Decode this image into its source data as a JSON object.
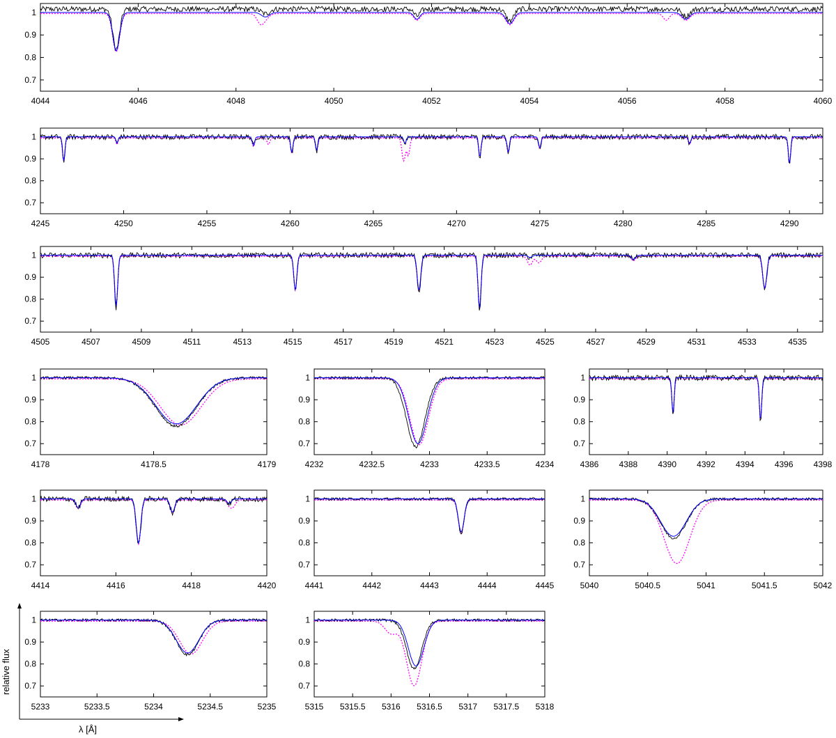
{
  "chart_data": [
    {
      "type": "line",
      "xlim": [
        4044,
        4060
      ],
      "ylim": [
        0.65,
        1.04
      ],
      "xticks": [
        "4044",
        "4046",
        "4048",
        "4050",
        "4052",
        "4054",
        "4056",
        "4058",
        "4060"
      ],
      "yticks": [
        "0.7",
        "0.8",
        "0.9",
        "1"
      ],
      "lines": [
        {
          "c": 4045.55,
          "d": 0.17,
          "w": 0.07
        },
        {
          "c": 4048.6,
          "d": 0.02,
          "w": 0.08
        },
        {
          "c": 4051.7,
          "d": 0.03,
          "w": 0.06
        },
        {
          "c": 4053.6,
          "d": 0.05,
          "w": 0.08
        },
        {
          "c": 4057.2,
          "d": 0.03,
          "w": 0.08
        }
      ],
      "extra": [
        {
          "c": 4048.5,
          "d": 0.04,
          "w": 0.07
        },
        {
          "c": 4056.8,
          "d": 0.03,
          "w": 0.06
        }
      ],
      "obs_offset": 0.015
    },
    {
      "type": "line",
      "xlim": [
        4245,
        4292
      ],
      "ylim": [
        0.65,
        1.04
      ],
      "xticks": [
        "4245",
        "4250",
        "4255",
        "4260",
        "4265",
        "4270",
        "4275",
        "4280",
        "4285",
        "4290"
      ],
      "yticks": [
        "0.7",
        "0.8",
        "0.9",
        "1"
      ],
      "lines": [
        {
          "c": 4246.4,
          "d": 0.11,
          "w": 0.07
        },
        {
          "c": 4249.6,
          "d": 0.03,
          "w": 0.06
        },
        {
          "c": 4257.8,
          "d": 0.04,
          "w": 0.07
        },
        {
          "c": 4260.1,
          "d": 0.07,
          "w": 0.07
        },
        {
          "c": 4261.6,
          "d": 0.06,
          "w": 0.07
        },
        {
          "c": 4266.9,
          "d": 0.03,
          "w": 0.07
        },
        {
          "c": 4271.4,
          "d": 0.09,
          "w": 0.07
        },
        {
          "c": 4273.1,
          "d": 0.07,
          "w": 0.07
        },
        {
          "c": 4275.0,
          "d": 0.05,
          "w": 0.07
        },
        {
          "c": 4284.0,
          "d": 0.03,
          "w": 0.07
        },
        {
          "c": 4290.0,
          "d": 0.12,
          "w": 0.07
        }
      ],
      "extra": [
        {
          "c": 4266.8,
          "d": 0.09,
          "w": 0.09
        },
        {
          "c": 4267.1,
          "d": 0.08,
          "w": 0.09
        },
        {
          "c": 4258.7,
          "d": 0.03,
          "w": 0.08
        }
      ],
      "obs_offset": 0
    },
    {
      "type": "line",
      "xlim": [
        4505,
        4536
      ],
      "ylim": [
        0.65,
        1.04
      ],
      "xticks": [
        "4505",
        "4507",
        "4509",
        "4511",
        "4513",
        "4515",
        "4517",
        "4519",
        "4521",
        "4523",
        "4525",
        "4527",
        "4529",
        "4531",
        "4533",
        "4535"
      ],
      "yticks": [
        "0.7",
        "0.8",
        "0.9",
        "1"
      ],
      "lines": [
        {
          "c": 4508.0,
          "d": 0.23,
          "w": 0.06
        },
        {
          "c": 4515.1,
          "d": 0.16,
          "w": 0.06
        },
        {
          "c": 4520.0,
          "d": 0.16,
          "w": 0.07
        },
        {
          "c": 4522.4,
          "d": 0.24,
          "w": 0.06
        },
        {
          "c": 4524.4,
          "d": 0.01,
          "w": 0.08
        },
        {
          "c": 4528.5,
          "d": 0.02,
          "w": 0.08
        },
        {
          "c": 4533.7,
          "d": 0.15,
          "w": 0.08
        }
      ],
      "extra": [
        {
          "c": 4524.4,
          "d": 0.03,
          "w": 0.1
        },
        {
          "c": 4524.75,
          "d": 0.03,
          "w": 0.1
        }
      ],
      "obs_offset": 0
    },
    {
      "type": "line",
      "xlim": [
        4178,
        4179
      ],
      "ylim": [
        0.65,
        1.04
      ],
      "xticks": [
        "4178",
        "4178.5",
        "4179"
      ],
      "yticks": [
        "0.7",
        "0.8",
        "0.9",
        "1"
      ],
      "lines": [
        {
          "c": 4178.6,
          "d": 0.21,
          "w": 0.09
        }
      ],
      "extra": [],
      "model_shift": 0.02,
      "fit_shift": 0,
      "obs_offset": 0
    },
    {
      "type": "line",
      "xlim": [
        4232,
        4234
      ],
      "ylim": [
        0.65,
        1.04
      ],
      "xticks": [
        "4232",
        "4232.5",
        "4233",
        "4233.5",
        "4234"
      ],
      "yticks": [
        "0.7",
        "0.8",
        "0.9",
        "1"
      ],
      "lines": [
        {
          "c": 4232.88,
          "d": 0.3,
          "w": 0.08
        }
      ],
      "extra": [],
      "model_shift": 0.03,
      "fit_shift": 0.04,
      "obs_offset": 0
    },
    {
      "type": "line",
      "xlim": [
        4386,
        4398
      ],
      "ylim": [
        0.65,
        1.04
      ],
      "xticks": [
        "4386",
        "4388",
        "4390",
        "4392",
        "4394",
        "4396",
        "4398"
      ],
      "yticks": [
        "0.7",
        "0.8",
        "0.9",
        "1"
      ],
      "lines": [
        {
          "c": 4390.3,
          "d": 0.16,
          "w": 0.06
        },
        {
          "c": 4394.8,
          "d": 0.19,
          "w": 0.06
        }
      ],
      "extra": [],
      "model_shift": 0,
      "fit_shift": 0,
      "obs_offset": 0
    },
    {
      "type": "line",
      "xlim": [
        4414,
        4420
      ],
      "ylim": [
        0.65,
        1.04
      ],
      "xticks": [
        "4414",
        "4416",
        "4418",
        "4420"
      ],
      "yticks": [
        "0.7",
        "0.8",
        "0.9",
        "1"
      ],
      "lines": [
        {
          "c": 4415.0,
          "d": 0.04,
          "w": 0.06
        },
        {
          "c": 4416.6,
          "d": 0.2,
          "w": 0.06
        },
        {
          "c": 4417.5,
          "d": 0.06,
          "w": 0.06
        },
        {
          "c": 4419.0,
          "d": 0.02,
          "w": 0.06
        }
      ],
      "extra": [
        {
          "c": 4419.1,
          "d": 0.03,
          "w": 0.07
        }
      ],
      "model_shift": 0,
      "fit_shift": 0,
      "obs_offset": 0
    },
    {
      "type": "line",
      "xlim": [
        4441,
        4445
      ],
      "ylim": [
        0.65,
        1.04
      ],
      "xticks": [
        "4441",
        "4442",
        "4443",
        "4444",
        "4445"
      ],
      "yticks": [
        "0.7",
        "0.8",
        "0.9",
        "1"
      ],
      "lines": [
        {
          "c": 4443.55,
          "d": 0.15,
          "w": 0.05
        }
      ],
      "extra": [],
      "model_shift": 0,
      "fit_shift": 0,
      "obs_offset": 0
    },
    {
      "type": "line",
      "xlim": [
        5040,
        5042
      ],
      "ylim": [
        0.65,
        1.04
      ],
      "xticks": [
        "5040",
        "5040.5",
        "5041",
        "5041.5",
        "5042"
      ],
      "yticks": [
        "0.7",
        "0.8",
        "0.9",
        "1"
      ],
      "lines": [
        {
          "c": 5040.72,
          "d": 0.17,
          "w": 0.11
        }
      ],
      "extra": [],
      "model_scale": 1.7,
      "model_shift": 0.03,
      "fit_shift": 0,
      "obs_offset": 0
    },
    {
      "type": "line",
      "xlim": [
        5233,
        5235
      ],
      "ylim": [
        0.65,
        1.04
      ],
      "xticks": [
        "5233",
        "5233.5",
        "5234",
        "5234.5",
        "5235"
      ],
      "yticks": [
        "0.7",
        "0.8",
        "0.9",
        "1"
      ],
      "lines": [
        {
          "c": 5234.3,
          "d": 0.15,
          "w": 0.1
        }
      ],
      "extra": [],
      "model_shift": 0.03,
      "fit_shift": 0,
      "obs_offset": 0
    },
    {
      "type": "line",
      "xlim": [
        5315,
        5318
      ],
      "ylim": [
        0.65,
        1.04
      ],
      "xticks": [
        "5315",
        "5315.5",
        "5316",
        "5316.5",
        "5317",
        "5317.5",
        "5318"
      ],
      "yticks": [
        "0.7",
        "0.8",
        "0.9",
        "1"
      ],
      "lines": [
        {
          "c": 5316.3,
          "d": 0.21,
          "w": 0.1
        }
      ],
      "extra": [
        {
          "c": 5316.0,
          "d": 0.04,
          "w": 0.08
        }
      ],
      "model_scale": 1.4,
      "model_shift": 0,
      "fit_shift": 0.05,
      "obs_offset": 0
    }
  ],
  "axes": {
    "ylabel": "relative flux",
    "xlabel": "λ [Å]"
  },
  "series_colors": {
    "observed": "#000000",
    "model_fit": "#0000ff",
    "model_alt": "#ff00ff"
  }
}
